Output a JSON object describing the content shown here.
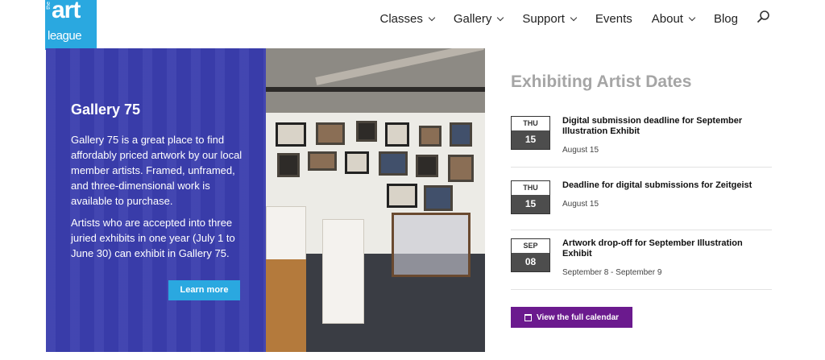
{
  "logo": {
    "the": "the",
    "art": "art",
    "league": "league"
  },
  "nav": {
    "items": [
      {
        "label": "Classes",
        "has_dropdown": true
      },
      {
        "label": "Gallery",
        "has_dropdown": true
      },
      {
        "label": "Support",
        "has_dropdown": true
      },
      {
        "label": "Events",
        "has_dropdown": false
      },
      {
        "label": "About",
        "has_dropdown": true
      },
      {
        "label": "Blog",
        "has_dropdown": false
      }
    ],
    "search_icon": "search-icon"
  },
  "hero": {
    "title": "Gallery 75",
    "paragraph1": "Gallery 75 is a great place to find affordably priced artwork by our local member artists. Framed, unframed, and three-dimensional work is available to purchase.",
    "paragraph2": "Artists who are accepted into three juried exhibits in one year (July 1 to June 30) can exhibit in Gallery 75.",
    "button_label": "Learn more"
  },
  "events": {
    "heading": "Exhibiting Artist Dates",
    "items": [
      {
        "dow": "THU",
        "day": "15",
        "title": "Digital submission deadline for September Illustration Exhibit",
        "date_text": "August 15"
      },
      {
        "dow": "THU",
        "day": "15",
        "title": "Deadline for digital submissions for Zeitgeist",
        "date_text": "August 15"
      },
      {
        "dow": "SEP",
        "day": "08",
        "title": "Artwork drop-off for September Illustration Exhibit",
        "date_text": "September 8 - September 9"
      }
    ],
    "calendar_button": "View the full calendar"
  },
  "colors": {
    "panel": "#3b3eae",
    "accent_blue": "#2aa8e0",
    "calendar_button": "#6b1a8e",
    "heading_gray": "#a5a5a5"
  }
}
